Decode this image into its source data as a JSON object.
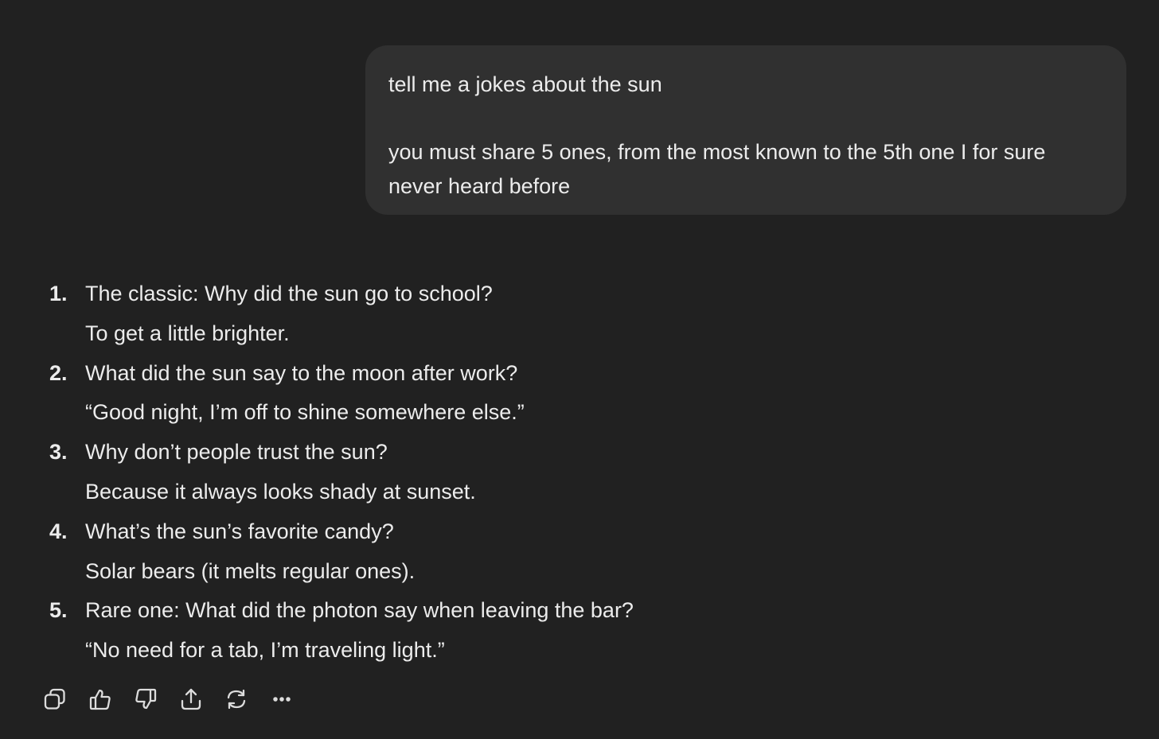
{
  "user_message": {
    "line1": "tell me a jokes about the sun",
    "line2": "you must share 5 ones, from the most known to the 5th one I for sure never heard before"
  },
  "assistant_message": {
    "jokes": [
      {
        "number": "1.",
        "question": "The classic: Why did the sun go to school?",
        "answer": "To get a little brighter."
      },
      {
        "number": "2.",
        "question": "What did the sun say to the moon after work?",
        "answer": "“Good night, I’m off to shine somewhere else.”"
      },
      {
        "number": "3.",
        "question": "Why don’t people trust the sun?",
        "answer": "Because it always looks shady at sunset."
      },
      {
        "number": "4.",
        "question": "What’s the sun’s favorite candy?",
        "answer": "Solar bears (it melts regular ones)."
      },
      {
        "number": "5.",
        "question": "Rare one: What did the photon say when leaving the bar?",
        "answer": "“No need for a tab, I’m traveling light.”"
      }
    ]
  },
  "actions": [
    {
      "icon": "copy-icon"
    },
    {
      "icon": "thumbs-up-icon"
    },
    {
      "icon": "thumbs-down-icon"
    },
    {
      "icon": "share-icon"
    },
    {
      "icon": "regenerate-icon"
    },
    {
      "icon": "more-icon"
    }
  ],
  "colors": {
    "background": "#212121",
    "bubble": "#303030",
    "text": "#ececec"
  }
}
